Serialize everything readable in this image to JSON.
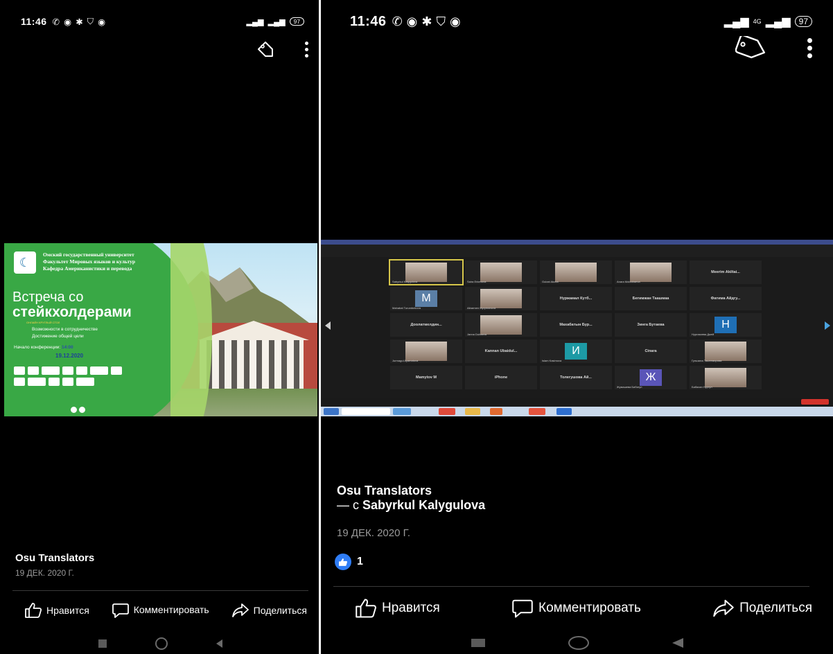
{
  "left": {
    "status": {
      "time": "11:46",
      "battery": "97"
    },
    "poster": {
      "university": "Омский государственный университет",
      "faculty": "Факультет Мировых языков и культур",
      "department": "Кафедра Американистики и перевода",
      "title_line1": "Встреча со",
      "title_line2": "стейкхолдерами",
      "subtitle": "ОНЛАЙН КРУГЛЫЙ СТОЛ",
      "point1": "Возможности в сотрудничестве",
      "point2": "Достижение общей цели",
      "start_label": "Начало конференции:",
      "start_time": "14:00",
      "date": "19.12.2020"
    },
    "post": {
      "title": "Osu Translators",
      "date": "19 ДЕК. 2020 Г."
    },
    "actions": {
      "like": "Нравится",
      "comment": "Комментировать",
      "share": "Поделиться"
    }
  },
  "right": {
    "status": {
      "time": "11:46",
      "network": "4G",
      "battery": "97"
    },
    "zoom": {
      "tiles": [
        {
          "type": "photo",
          "name": "Sabyrkul Kalygulova"
        },
        {
          "type": "photo",
          "name": "Saira Erkenova"
        },
        {
          "type": "photo",
          "name": "Gulzat Akcha"
        },
        {
          "type": "photo",
          "name": "Anara Moldobaeva"
        },
        {
          "type": "label",
          "name": "Meerim Akiltai..."
        },
        {
          "type": "letter",
          "letter": "M",
          "color": "#5b7fa6",
          "name": "Mahabat Turumbekova"
        },
        {
          "type": "photo",
          "name": "Aibarmen Myrymanova"
        },
        {
          "type": "label",
          "name": "Нуржамал Кутб..."
        },
        {
          "type": "label",
          "name": "Бегимжан Таашмаа"
        },
        {
          "type": "label",
          "name": "Фатима Айдгу..."
        },
        {
          "type": "label",
          "name": "Доолатмелдин..."
        },
        {
          "type": "photo",
          "name": "Janna Duhaeva"
        },
        {
          "type": "label",
          "name": "Махабатын Бур..."
        },
        {
          "type": "label",
          "name": "Зинга Бутаева"
        },
        {
          "type": "letter",
          "letter": "Н",
          "color": "#1f6fb5",
          "name": "Нургазиева Джей"
        },
        {
          "type": "photo",
          "name": "Jurmagul Ayamatova"
        },
        {
          "type": "label",
          "name": "Kannan Ubaidul..."
        },
        {
          "type": "letter",
          "letter": "И",
          "color": "#1d9aa5",
          "name": "Islam Kasimova"
        },
        {
          "type": "label",
          "name": "Cinara"
        },
        {
          "type": "photo",
          "name": "Гульзина Таштемирова"
        },
        {
          "type": "label",
          "name": "Mamytov M"
        },
        {
          "type": "label",
          "name": "iPhone"
        },
        {
          "type": "label",
          "name": "Толегушова Ай..."
        },
        {
          "type": "letter",
          "letter": "Ж",
          "color": "#5a55b8",
          "name": "Жумашева Бибигул"
        },
        {
          "type": "photo",
          "name": "Бабахан Нургул"
        }
      ]
    },
    "post": {
      "title": "Osu Translators",
      "with_prefix": "— с",
      "with_name": "Sabyrkul Kalygulova",
      "date": "19 ДЕК. 2020 Г.",
      "reaction_count": "1"
    },
    "actions": {
      "like": "Нравится",
      "comment": "Комментировать",
      "share": "Поделиться"
    }
  },
  "colors": {
    "like_blue": "#2f7df6",
    "zoom_end_red": "#d3332c"
  },
  "icons": [
    "tag-icon",
    "more-vert-icon",
    "thumb-up-icon",
    "comment-icon",
    "share-icon",
    "nav-recents-icon",
    "nav-home-icon",
    "nav-back-icon"
  ]
}
